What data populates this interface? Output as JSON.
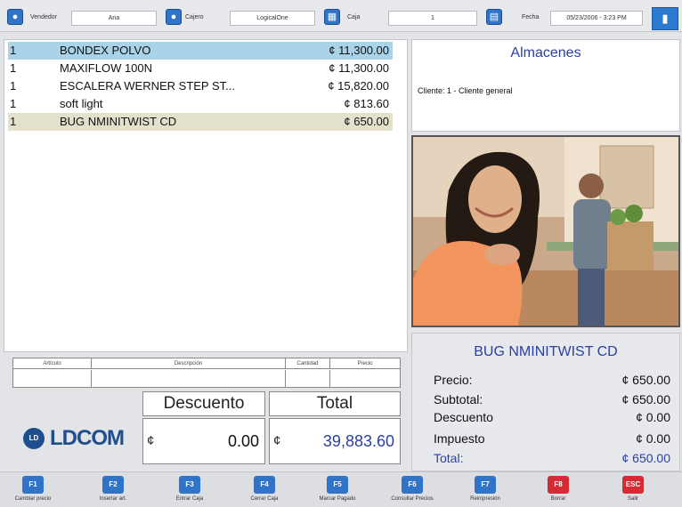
{
  "topbar": {
    "vendedor_label": "Vendedor",
    "vendedor_value": "Ana",
    "cajero_label": "Cajero",
    "cajero_value": "LogicalOne",
    "caja_label": "Caja",
    "caja_value": "1",
    "fecha_label": "Fecha",
    "fecha_value": "05/23/2006 - 3:23 PM"
  },
  "items": [
    {
      "qty": "1",
      "desc": "BONDEX POLVO",
      "price": "¢ 11,300.00"
    },
    {
      "qty": "1",
      "desc": "MAXIFLOW 100N",
      "price": "¢ 11,300.00"
    },
    {
      "qty": "1",
      "desc": "ESCALERA WERNER STEP ST...",
      "price": "¢ 15,820.00"
    },
    {
      "qty": "1",
      "desc": "soft light",
      "price": "¢ 813.60"
    },
    {
      "qty": "1",
      "desc": "BUG NMINITWIST CD",
      "price": "¢ 650.00"
    }
  ],
  "grid": {
    "headers": [
      "Artículo",
      "Descripción",
      "Cantidad",
      "Precio"
    ]
  },
  "logo": {
    "text": "LDCOM",
    "mark": "LD"
  },
  "totals": {
    "descuento_label": "Descuento",
    "total_label": "Total",
    "currency": "¢",
    "descuento_value": "0.00",
    "total_value": "39,883.60"
  },
  "right": {
    "warehouse_title": "Almacenes",
    "client_text": "Cliente: 1 - Cliente general",
    "product_title": "BUG NMINITWIST CD",
    "precio_label": "Precio:",
    "precio_value": "¢ 650.00",
    "subtotal_label": "Subtotal:",
    "subtotal_value": "¢ 650.00",
    "descuento_label": "Descuento",
    "descuento_value": "¢ 0.00",
    "impuesto_label": "Impuesto",
    "impuesto_value": "¢ 0.00",
    "total_label": "Total:",
    "total_value": "¢ 650.00"
  },
  "fkeys": [
    {
      "key": "F1",
      "label": "Cambiar precio",
      "color": "#2f74c8"
    },
    {
      "key": "F2",
      "label": "Insertar art.",
      "color": "#2f74c8"
    },
    {
      "key": "F3",
      "label": "Entrar Caja",
      "color": "#2f74c8"
    },
    {
      "key": "F4",
      "label": "Cerrar Caja",
      "color": "#2f74c8"
    },
    {
      "key": "F5",
      "label": "Marcar Pagado",
      "color": "#2f74c8"
    },
    {
      "key": "F6",
      "label": "Consultar Precios",
      "color": "#2f74c8"
    },
    {
      "key": "F7",
      "label": "Reimpresión",
      "color": "#2f74c8"
    },
    {
      "key": "F8",
      "label": "Borrar",
      "color": "#d62b35"
    },
    {
      "key": "ESC",
      "label": "Salir",
      "color": "#d62b35"
    }
  ]
}
